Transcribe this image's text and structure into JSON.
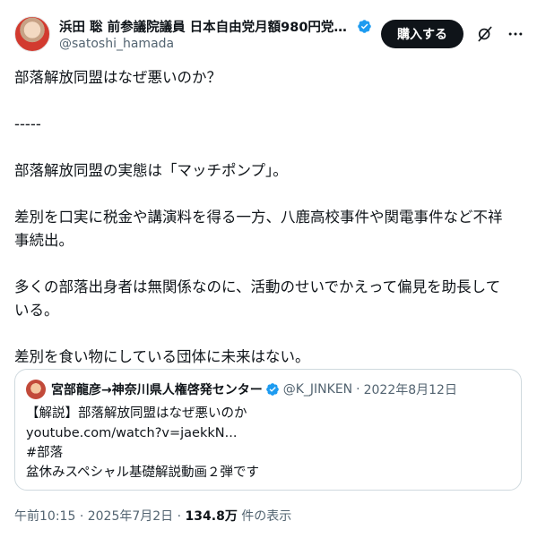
{
  "author": {
    "display_name": "浜田 聡 前参議院議員 日本自由党月額980円党員...",
    "handle": "@satoshi_hamada"
  },
  "header": {
    "buy_label": "購入する"
  },
  "post": {
    "lines": [
      "部落解放同盟はなぜ悪いのか？",
      "",
      "-----",
      "",
      "部落解放同盟の実態は「マッチポンプ」。",
      "",
      "差別を口実に税金や講演料を得る一方、八鹿高校事件や関電事件など不祥",
      "事続出。",
      "",
      "多くの部落出身者は無関係なのに、活動のせいでかえって偏見を助長して",
      "いる。",
      "",
      "差別を食い物にしている団体に未来はない。"
    ]
  },
  "quote": {
    "display_name": "宮部龍彦→神奈川県人権啓発センター",
    "handle": "@K_JINKEN",
    "separator": "·",
    "date": "2022年8月12日",
    "lines": [
      "【解説】部落解放同盟はなぜ悪いのか",
      "youtube.com/watch?v=jaekkN...",
      "#部落",
      "盆休みスペシャル基礎解説動画２弾です"
    ]
  },
  "meta": {
    "time": "午前10:15",
    "separator": "·",
    "date": "2025年7月2日",
    "separator2": "·",
    "views_count": "134.8万",
    "views_label": "件の表示"
  },
  "colors": {
    "text": "#0f1419",
    "secondary": "#536471",
    "verified": "#1d9bf0",
    "border": "#cfd9de",
    "button_bg": "#0f1419"
  },
  "icons": {
    "verified": "verified-badge-icon",
    "grok": "grok-icon",
    "more": "more-dots-icon"
  }
}
